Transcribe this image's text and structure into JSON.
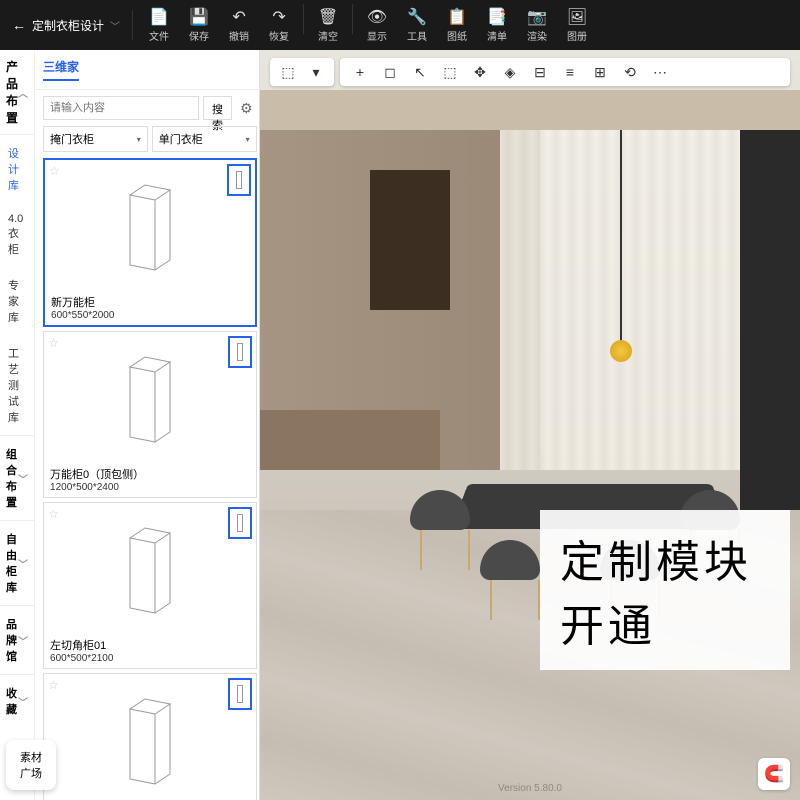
{
  "header": {
    "title": "定制衣柜设计",
    "tools": [
      {
        "icon": "📄",
        "label": "文件"
      },
      {
        "icon": "💾",
        "label": "保存"
      },
      {
        "icon": "↶",
        "label": "撤销"
      },
      {
        "icon": "↷",
        "label": "恢复"
      },
      {
        "icon": "🗑",
        "label": "清空"
      },
      {
        "icon": "👁",
        "label": "显示"
      },
      {
        "icon": "🔧",
        "label": "工具"
      },
      {
        "icon": "📋",
        "label": "图纸"
      },
      {
        "icon": "📑",
        "label": "清单"
      },
      {
        "icon": "📷",
        "label": "渲染"
      },
      {
        "icon": "🖼",
        "label": "图册"
      }
    ]
  },
  "nav": {
    "header": "产品布置",
    "items": [
      "设计库",
      "4.0衣柜",
      "专家库",
      "工艺测试库"
    ],
    "activeIndex": 0,
    "groups": [
      "组合布置",
      "自由柜库",
      "品牌馆",
      "收藏"
    ]
  },
  "content": {
    "tab": "三维家",
    "searchPlaceholder": "请输入内容",
    "searchBtn": "搜索",
    "dropdown1": "掩门衣柜",
    "dropdown2": "单门衣柜",
    "items": [
      {
        "name": "新万能柜",
        "dims": "600*550*2000",
        "selected": true
      },
      {
        "name": "万能柜0（顶包侧）",
        "dims": "1200*500*2400",
        "selected": false
      },
      {
        "name": "左切角柜01",
        "dims": "600*500*2100",
        "selected": false
      },
      {
        "name": "",
        "dims": "",
        "selected": false
      }
    ]
  },
  "overlay": "定制模块开通",
  "materialBtn": "素材\n广场",
  "version": "Version 5.80.0"
}
